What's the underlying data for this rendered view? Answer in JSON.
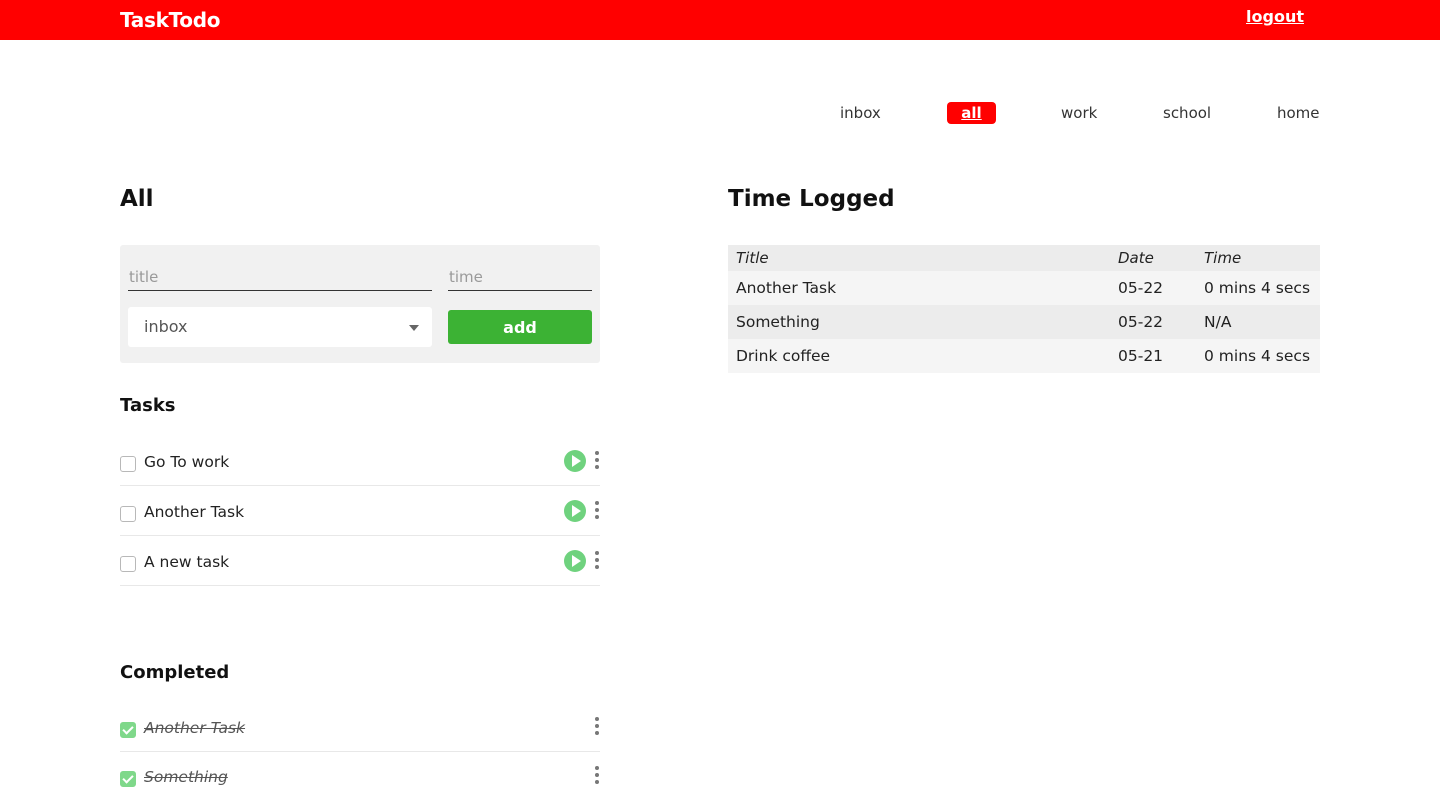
{
  "app": {
    "brand": "TaskTodo",
    "logout_label": "logout"
  },
  "categories": [
    {
      "label": "inbox",
      "active": false
    },
    {
      "label": "all",
      "active": true
    },
    {
      "label": "work",
      "active": false
    },
    {
      "label": "school",
      "active": false
    },
    {
      "label": "home",
      "active": false
    }
  ],
  "main": {
    "heading": "All",
    "form": {
      "title_placeholder": "title",
      "time_placeholder": "time",
      "category_selected": "inbox",
      "add_label": "add"
    },
    "tasks_heading": "Tasks",
    "tasks": [
      {
        "label": "Go To work",
        "done": false
      },
      {
        "label": "Another Task",
        "done": false
      },
      {
        "label": "A new task",
        "done": false
      }
    ],
    "completed_heading": "Completed",
    "completed": [
      {
        "label": "Another Task",
        "done": true
      },
      {
        "label": "Something",
        "done": true
      }
    ]
  },
  "time_logged": {
    "heading": "Time Logged",
    "columns": [
      "Title",
      "Date",
      "Time"
    ],
    "rows": [
      [
        "Another Task",
        "05-22",
        "0 mins 4 secs"
      ],
      [
        "Something",
        "05-22",
        "N/A"
      ],
      [
        "Drink coffee",
        "05-21",
        "0 mins 4 secs"
      ]
    ]
  },
  "icons": {
    "play": "play-icon",
    "more": "more-vertical-icon",
    "caret": "chevron-down-icon",
    "check": "check-icon"
  },
  "colors": {
    "header": "#ff0000",
    "add_button": "#3cb234",
    "play": "#6fd27e",
    "checked": "#7fd88a"
  }
}
